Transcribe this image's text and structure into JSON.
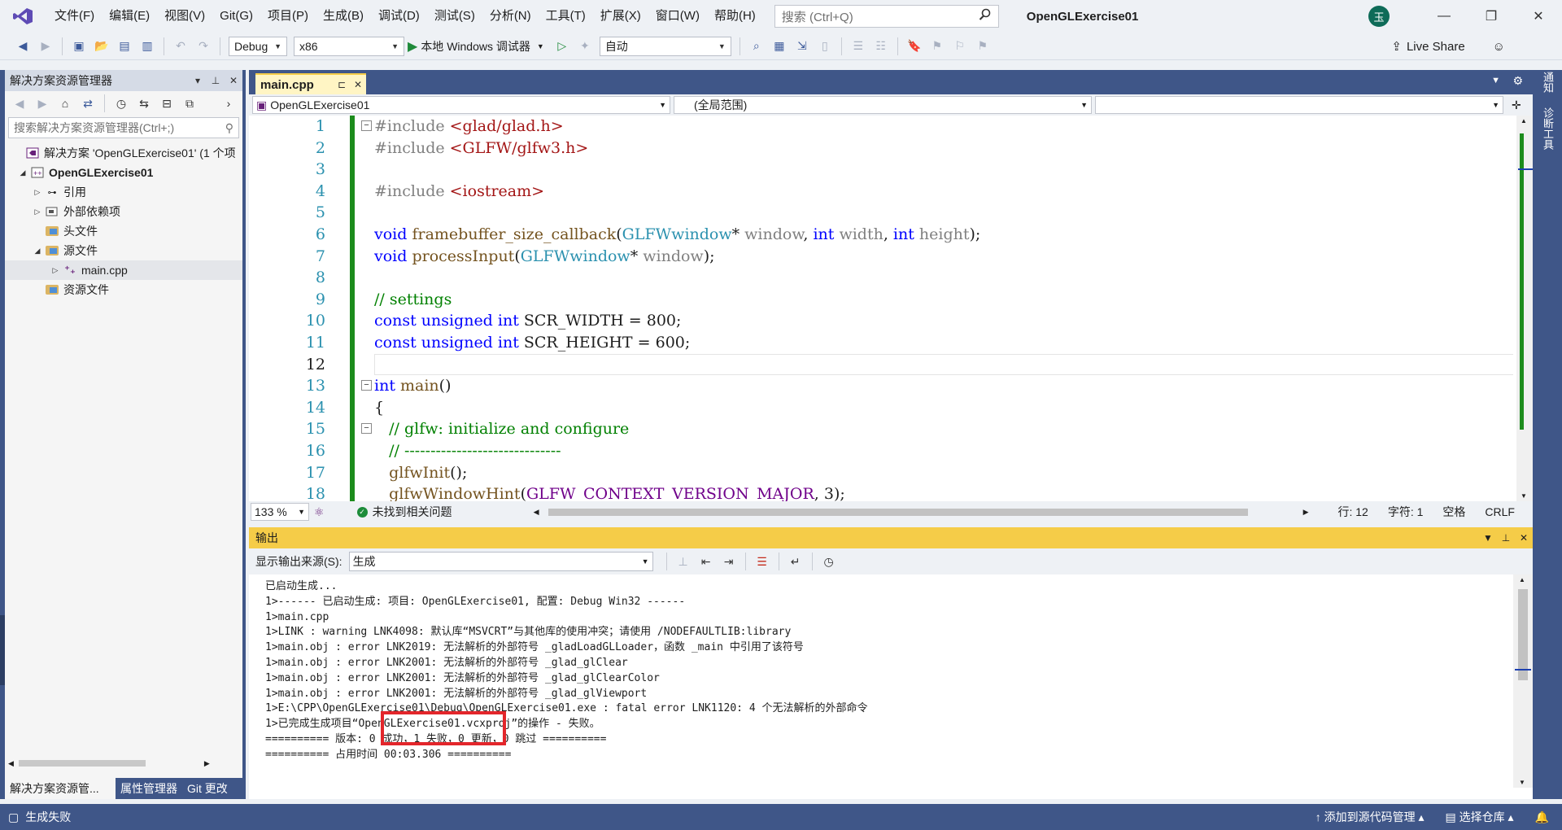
{
  "app": {
    "title": "OpenGLExercise01",
    "avatar_initial": "玉",
    "menu": [
      "文件(F)",
      "编辑(E)",
      "视图(V)",
      "Git(G)",
      "项目(P)",
      "生成(B)",
      "调试(D)",
      "测试(S)",
      "分析(N)",
      "工具(T)",
      "扩展(X)",
      "窗口(W)",
      "帮助(H)"
    ],
    "search_placeholder": "搜索 (Ctrl+Q)"
  },
  "toolbar": {
    "configuration": "Debug",
    "platform": "x86",
    "debugger_label": "本地 Windows 调试器",
    "auto_combo": "自动",
    "live_share": "Live Share"
  },
  "solution_explorer": {
    "title": "解决方案资源管理器",
    "search_placeholder": "搜索解决方案资源管理器(Ctrl+;)",
    "tree": [
      {
        "label": "解决方案 'OpenGLExercise01' (1 个项",
        "indent": 0
      },
      {
        "label": "OpenGLExercise01",
        "indent": 1,
        "bold": true
      },
      {
        "label": "引用",
        "indent": 2
      },
      {
        "label": "外部依赖项",
        "indent": 2
      },
      {
        "label": "头文件",
        "indent": 2
      },
      {
        "label": "源文件",
        "indent": 2
      },
      {
        "label": "main.cpp",
        "indent": 3
      },
      {
        "label": "资源文件",
        "indent": 2
      }
    ],
    "bottom_tabs": [
      "解决方案资源管...",
      "属性管理器",
      "Git 更改"
    ]
  },
  "editor": {
    "tab_name": "main.cpp",
    "nav_project": "OpenGLExercise01",
    "nav_scope": "(全局范围)",
    "nav_member": "",
    "line_numbers": [
      "1",
      "2",
      "3",
      "4",
      "5",
      "6",
      "7",
      "8",
      "9",
      "10",
      "11",
      "12",
      "13",
      "14",
      "15",
      "16",
      "17",
      "18"
    ],
    "code": {
      "inc1_d": "#include ",
      "inc1_p": "<glad/glad.h>",
      "inc2_d": "#include ",
      "inc2_p": "<GLFW/glfw3.h>",
      "inc3_d": "#include ",
      "inc3_p": "<iostream>",
      "l6_kw": "void",
      "l6_fn": "framebuffer_size_callback",
      "l6_a": "(",
      "l6_ty": "GLFWwindow",
      "l6_b": "* ",
      "l6_p1": "window",
      "l6_c": ", ",
      "l6_kw2": "int",
      "l6_d": " ",
      "l6_p2": "width",
      "l6_e": ", ",
      "l6_kw3": "int",
      "l6_f": " ",
      "l6_p3": "height",
      "l6_g": ");",
      "l7_kw": "void",
      "l7_fn": "processInput",
      "l7_a": "(",
      "l7_ty": "GLFWwindow",
      "l7_b": "* ",
      "l7_p1": "window",
      "l7_c": ");",
      "l9": "// settings",
      "l10_kw": "const unsigned int",
      "l10_rest": " SCR_WIDTH = 800;",
      "l11_kw": "const unsigned int",
      "l11_rest": " SCR_HEIGHT = 600;",
      "l13_kw": "int",
      "l13_fn": "main",
      "l13_rest": "()",
      "l14": "{",
      "l15": "// glfw: initialize and configure",
      "l16": "// ------------------------------",
      "l17_fn": "glfwInit",
      "l17_rest": "();",
      "l18_fn": "glfwWindowHint",
      "l18_a": "(",
      "l18_mc": "GLFW_CONTEXT_VERSION_MAJOR",
      "l18_rest": ", 3);"
    },
    "zoom": "133 %",
    "issues": "未找到相关问题",
    "line_label": "行: 12",
    "col_label": "字符: 1",
    "indent_label": "空格",
    "eol_label": "CRLF"
  },
  "output": {
    "title": "输出",
    "source_label": "显示输出来源(S):",
    "source_value": "生成",
    "lines": [
      "已启动生成...",
      "1>------ 已启动生成: 项目: OpenGLExercise01, 配置: Debug Win32 ------",
      "1>main.cpp",
      "1>LINK : warning LNK4098: 默认库“MSVCRT”与其他库的使用冲突；请使用 /NODEFAULTLIB:library",
      "1>main.obj : error LNK2019: 无法解析的外部符号 _gladLoadGLLoader，函数 _main 中引用了该符号",
      "1>main.obj : error LNK2001: 无法解析的外部符号 _glad_glClear",
      "1>main.obj : error LNK2001: 无法解析的外部符号 _glad_glClearColor",
      "1>main.obj : error LNK2001: 无法解析的外部符号 _glad_glViewport",
      "1>E:\\CPP\\OpenGLExercise01\\Debug\\OpenGLExercise01.exe : fatal error LNK1120: 4 个无法解析的外部命令",
      "1>已完成生成项目“OpenGLExercise01.vcxproj”的操作 - 失败。",
      "========== 版本: 0 成功，1 失败，0 更新，0 跳过 ==========",
      "========== 占用时间 00:03.306 =========="
    ]
  },
  "right_rail": [
    "通知",
    "诊断工具"
  ],
  "statusbar": {
    "message": "生成失败",
    "source_control": "添加到源代码管理",
    "repo": "选择仓库"
  },
  "colors": {
    "accent": "#3f5688",
    "output_header": "#f5cc48",
    "highlight_box": "#e3262b",
    "change_bar": "#1c8c1c"
  }
}
